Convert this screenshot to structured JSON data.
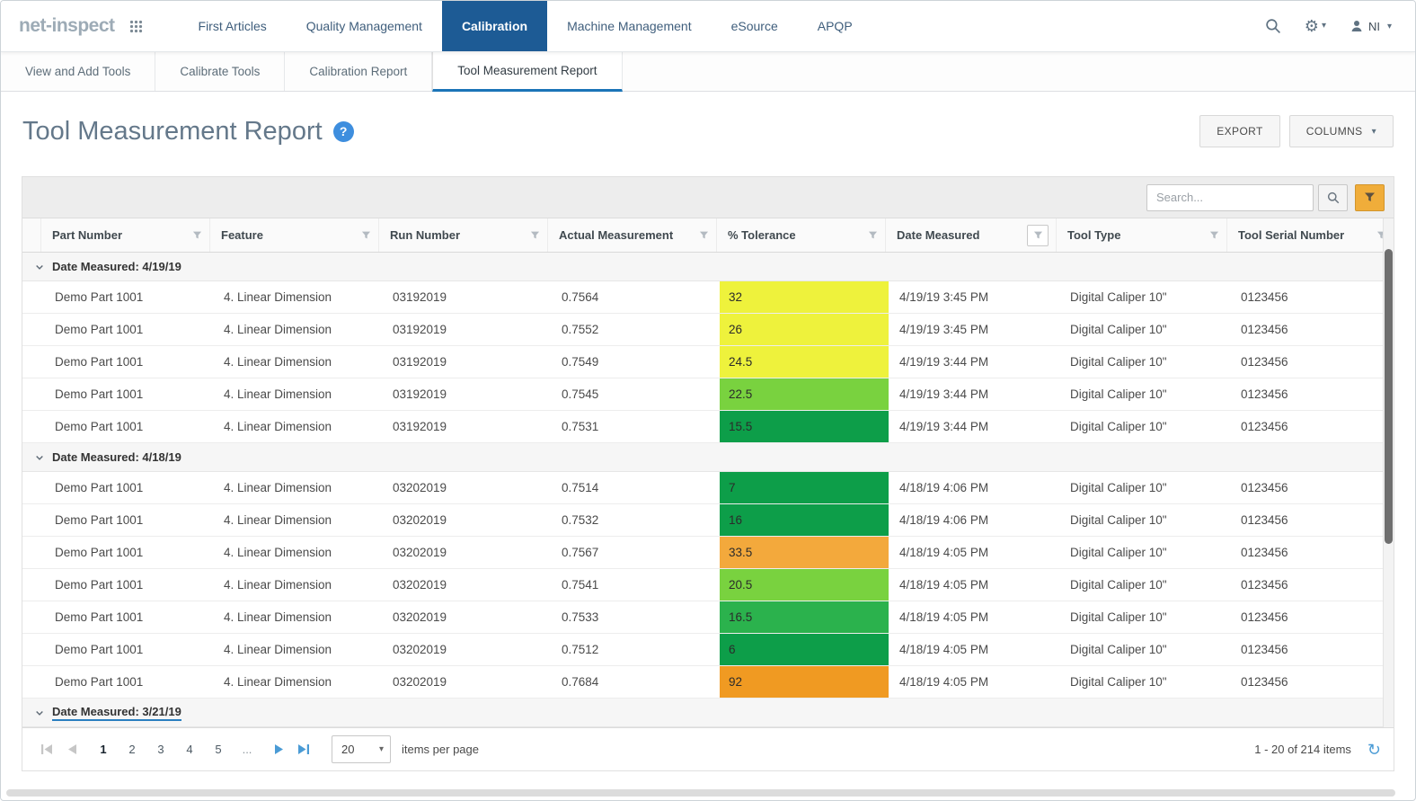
{
  "brand": {
    "logo": "net-inspect"
  },
  "nav": {
    "items": [
      {
        "label": "First Articles",
        "active": false
      },
      {
        "label": "Quality Management",
        "active": false
      },
      {
        "label": "Calibration",
        "active": true
      },
      {
        "label": "Machine Management",
        "active": false
      },
      {
        "label": "eSource",
        "active": false
      },
      {
        "label": "APQP",
        "active": false
      }
    ],
    "user_initials": "NI"
  },
  "subtabs": [
    {
      "label": "View and Add Tools",
      "active": false
    },
    {
      "label": "Calibrate Tools",
      "active": false
    },
    {
      "label": "Calibration Report",
      "active": false
    },
    {
      "label": "Tool Measurement Report",
      "active": true
    }
  ],
  "page": {
    "title": "Tool Measurement Report"
  },
  "actions": {
    "export": "EXPORT",
    "columns": "COLUMNS"
  },
  "search": {
    "placeholder": "Search..."
  },
  "icons": {
    "gear": "⚙",
    "caret": "▾",
    "refresh": "↻",
    "help": "?"
  },
  "grid": {
    "columns": [
      {
        "label": "Part Number"
      },
      {
        "label": "Feature"
      },
      {
        "label": "Run Number"
      },
      {
        "label": "Actual Measurement"
      },
      {
        "label": "% Tolerance"
      },
      {
        "label": "Date Measured",
        "filter_boxed": true
      },
      {
        "label": "Tool Type"
      },
      {
        "label": "Tool Serial Number"
      }
    ],
    "groups": [
      {
        "label": "Date Measured: 4/19/19",
        "rows": [
          {
            "part": "Demo Part 1001",
            "feature": "4. Linear Dimension",
            "run": "03192019",
            "actual": "0.7564",
            "tolerance": "32",
            "tol_color": "#eef23c",
            "date": "4/19/19 3:45 PM",
            "tool_type": "Digital Caliper 10\"",
            "serial": "0123456"
          },
          {
            "part": "Demo Part 1001",
            "feature": "4. Linear Dimension",
            "run": "03192019",
            "actual": "0.7552",
            "tolerance": "26",
            "tol_color": "#eef23c",
            "date": "4/19/19 3:45 PM",
            "tool_type": "Digital Caliper 10\"",
            "serial": "0123456"
          },
          {
            "part": "Demo Part 1001",
            "feature": "4. Linear Dimension",
            "run": "03192019",
            "actual": "0.7549",
            "tolerance": "24.5",
            "tol_color": "#eef23c",
            "date": "4/19/19 3:44 PM",
            "tool_type": "Digital Caliper 10\"",
            "serial": "0123456"
          },
          {
            "part": "Demo Part 1001",
            "feature": "4. Linear Dimension",
            "run": "03192019",
            "actual": "0.7545",
            "tolerance": "22.5",
            "tol_color": "#79d23f",
            "date": "4/19/19 3:44 PM",
            "tool_type": "Digital Caliper 10\"",
            "serial": "0123456"
          },
          {
            "part": "Demo Part 1001",
            "feature": "4. Linear Dimension",
            "run": "03192019",
            "actual": "0.7531",
            "tolerance": "15.5",
            "tol_color": "#0d9e49",
            "date": "4/19/19 3:44 PM",
            "tool_type": "Digital Caliper 10\"",
            "serial": "0123456"
          }
        ]
      },
      {
        "label": "Date Measured: 4/18/19",
        "rows": [
          {
            "part": "Demo Part 1001",
            "feature": "4. Linear Dimension",
            "run": "03202019",
            "actual": "0.7514",
            "tolerance": "7",
            "tol_color": "#0d9e49",
            "date": "4/18/19 4:06 PM",
            "tool_type": "Digital Caliper 10\"",
            "serial": "0123456"
          },
          {
            "part": "Demo Part 1001",
            "feature": "4. Linear Dimension",
            "run": "03202019",
            "actual": "0.7532",
            "tolerance": "16",
            "tol_color": "#0d9e49",
            "date": "4/18/19 4:06 PM",
            "tool_type": "Digital Caliper 10\"",
            "serial": "0123456"
          },
          {
            "part": "Demo Part 1001",
            "feature": "4. Linear Dimension",
            "run": "03202019",
            "actual": "0.7567",
            "tolerance": "33.5",
            "tol_color": "#f3a93c",
            "date": "4/18/19 4:05 PM",
            "tool_type": "Digital Caliper 10\"",
            "serial": "0123456"
          },
          {
            "part": "Demo Part 1001",
            "feature": "4. Linear Dimension",
            "run": "03202019",
            "actual": "0.7541",
            "tolerance": "20.5",
            "tol_color": "#79d23f",
            "date": "4/18/19 4:05 PM",
            "tool_type": "Digital Caliper 10\"",
            "serial": "0123456"
          },
          {
            "part": "Demo Part 1001",
            "feature": "4. Linear Dimension",
            "run": "03202019",
            "actual": "0.7533",
            "tolerance": "16.5",
            "tol_color": "#2bb24d",
            "date": "4/18/19 4:05 PM",
            "tool_type": "Digital Caliper 10\"",
            "serial": "0123456"
          },
          {
            "part": "Demo Part 1001",
            "feature": "4. Linear Dimension",
            "run": "03202019",
            "actual": "0.7512",
            "tolerance": "6",
            "tol_color": "#0d9e49",
            "date": "4/18/19 4:05 PM",
            "tool_type": "Digital Caliper 10\"",
            "serial": "0123456"
          },
          {
            "part": "Demo Part 1001",
            "feature": "4. Linear Dimension",
            "run": "03202019",
            "actual": "0.7684",
            "tolerance": "92",
            "tol_color": "#f09a22",
            "date": "4/18/19 4:05 PM",
            "tool_type": "Digital Caliper 10\"",
            "serial": "0123456"
          }
        ]
      },
      {
        "label": "Date Measured: 3/21/19",
        "underline": true,
        "rows": []
      }
    ]
  },
  "pagination": {
    "pages": [
      "1",
      "2",
      "3",
      "4",
      "5"
    ],
    "current": "1",
    "ellipsis": "...",
    "page_size": "20",
    "items_per_page_label": "items per page",
    "range_label": "1 - 20 of 214 items"
  },
  "colors": {
    "nav_active": "#1d5b95",
    "tab_underline": "#1b74b8",
    "link_blue": "#4a9bd5",
    "filter_button": "#f0ad3a",
    "tolerance_yellow": "#eef23c",
    "tolerance_light_green": "#79d23f",
    "tolerance_green": "#0d9e49",
    "tolerance_mid_green": "#2bb24d",
    "tolerance_orange": "#f3a93c",
    "tolerance_dark_orange": "#f09a22"
  }
}
